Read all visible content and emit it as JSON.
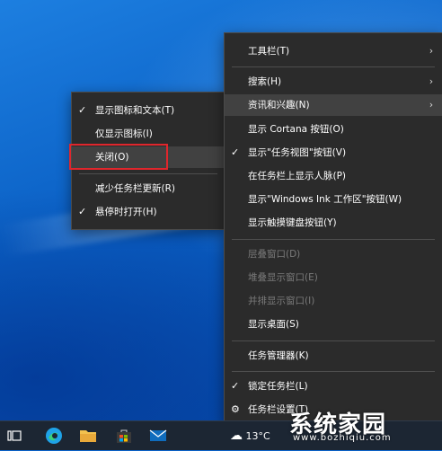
{
  "left_menu": {
    "items": [
      {
        "label": "显示图标和文本(T)",
        "checked": true
      },
      {
        "label": "仅显示图标(I)",
        "checked": false
      },
      {
        "label": "关闭(O)",
        "checked": false
      },
      {
        "label": "减少任务栏更新(R)",
        "checked": false
      },
      {
        "label": "悬停时打开(H)",
        "checked": true
      }
    ]
  },
  "right_menu": {
    "toolbar": "工具栏(T)",
    "search": "搜索(H)",
    "news": "资讯和兴趣(N)",
    "cortana": "显示 Cortana 按钮(O)",
    "taskview": "显示\"任务视图\"按钮(V)",
    "people": "在任务栏上显示人脉(P)",
    "ink": "显示\"Windows Ink 工作区\"按钮(W)",
    "touch_keyboard": "显示触摸键盘按钮(Y)",
    "cascade": "层叠窗口(D)",
    "stacked": "堆叠显示窗口(E)",
    "side_by_side": "并排显示窗口(I)",
    "show_desktop": "显示桌面(S)",
    "task_manager": "任务管理器(K)",
    "lock_taskbar": "锁定任务栏(L)",
    "taskbar_settings": "任务栏设置(T)"
  },
  "taskbar": {
    "weather_temp": "13°C"
  },
  "watermark": {
    "title": "系统家园",
    "url": "www.bozhiqiu.com"
  },
  "colors": {
    "menu_bg": "#2b2b2b",
    "hover_bg": "#414141",
    "highlight_red": "#e0262c",
    "taskbar_bg": "#1c2633"
  }
}
